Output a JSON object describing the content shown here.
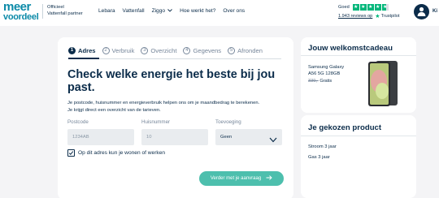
{
  "header": {
    "logo_top": "meer",
    "logo_bottom": "voordeel",
    "partner_line1": "Officieel",
    "partner_line2": "Vattenfall partner",
    "nav": [
      {
        "label": "Lebara"
      },
      {
        "label": "Vattenfall"
      },
      {
        "label": "Ziggo",
        "dropdown": true
      },
      {
        "label": "Hoe werkt het?"
      },
      {
        "label": "Over ons"
      }
    ],
    "review_label": "Goed",
    "review_count": "1.943 reviews op",
    "review_platform": "Trustpilot",
    "user_cut_text": "Ki",
    "trustpilot_color": "#00b67a"
  },
  "steps": [
    {
      "num": "1",
      "label": "Adres",
      "active": true
    },
    {
      "num": "2",
      "label": "Verbruik"
    },
    {
      "num": "3",
      "label": "Overzicht"
    },
    {
      "num": "4",
      "label": "Gegevens"
    },
    {
      "num": "5",
      "label": "Afronden"
    }
  ],
  "form": {
    "heading": "Check welke energie het beste bij jou past.",
    "description_line1": "Je postcode, huisnummer en energieverbruik helpen ons om je maandbedrag te berekenen.",
    "description_line2": "Je krijgt direct een overzicht van de tarieven.",
    "postcode_label": "Postcode",
    "postcode_placeholder": "1234AB",
    "huisnummer_label": "Huisnummer",
    "huisnummer_placeholder": "10",
    "toevoeging_label": "Toevoeging",
    "toevoeging_value": "Geen",
    "checkbox_label": "Op dit adres kun je wonen of werken",
    "checkbox_checked": true,
    "submit_label": "Verder met je aanvraag"
  },
  "welcome": {
    "title": "Jouw welkomstcadeau",
    "product_line1": "Samsung Galaxy",
    "product_line2": "A56 5G 128GB",
    "old_price": "339,-",
    "price_label": "Gratis"
  },
  "chosen": {
    "title": "Je gekozen product",
    "items": [
      "Stroom 3 jaar",
      "Gas 3 jaar"
    ]
  },
  "colors": {
    "primary_dark": "#0b2c4a",
    "brand": "#0b8aa8",
    "cta": "#4dbfad"
  }
}
